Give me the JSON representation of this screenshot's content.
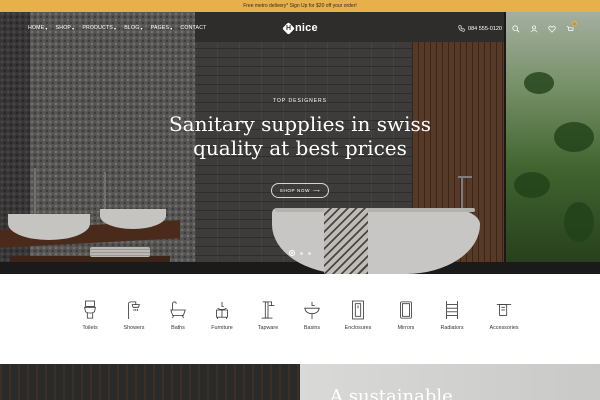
{
  "announcement": "Free metro delivery* Sign Up for $20 off your order!",
  "nav": {
    "items": [
      {
        "label": "HOME",
        "caret": true
      },
      {
        "label": "SHOP",
        "caret": true
      },
      {
        "label": "PRODUCTS",
        "caret": true
      },
      {
        "label": "BLOG",
        "caret": true
      },
      {
        "label": "PAGES",
        "caret": true
      },
      {
        "label": "CONTACT",
        "caret": false
      }
    ],
    "logo_mark": "H",
    "logo_text": "nice",
    "phone": "084 555-0120",
    "cart_count": "0"
  },
  "hero": {
    "eyebrow": "TOP DESIGNERS",
    "headline_line1": "Sanitary supplies in swiss",
    "headline_line2": "quality at best prices",
    "cta": "SHOP NOW",
    "slides": 3,
    "active_slide": 1
  },
  "categories": [
    {
      "label": "Toilets",
      "icon": "toilet-icon"
    },
    {
      "label": "Showers",
      "icon": "shower-icon"
    },
    {
      "label": "Baths",
      "icon": "bath-icon"
    },
    {
      "label": "Furniture",
      "icon": "furniture-icon"
    },
    {
      "label": "Tapware",
      "icon": "tap-icon"
    },
    {
      "label": "Basins",
      "icon": "basin-icon"
    },
    {
      "label": "Enclosures",
      "icon": "enclosure-icon"
    },
    {
      "label": "Mirrors",
      "icon": "mirror-icon"
    },
    {
      "label": "Radiators",
      "icon": "radiator-icon"
    },
    {
      "label": "Accessories",
      "icon": "accessories-icon"
    }
  ],
  "promo": {
    "heading_partial": "A sustainable"
  },
  "colors": {
    "accent": "#e8b04a",
    "text_dark": "#222222"
  }
}
